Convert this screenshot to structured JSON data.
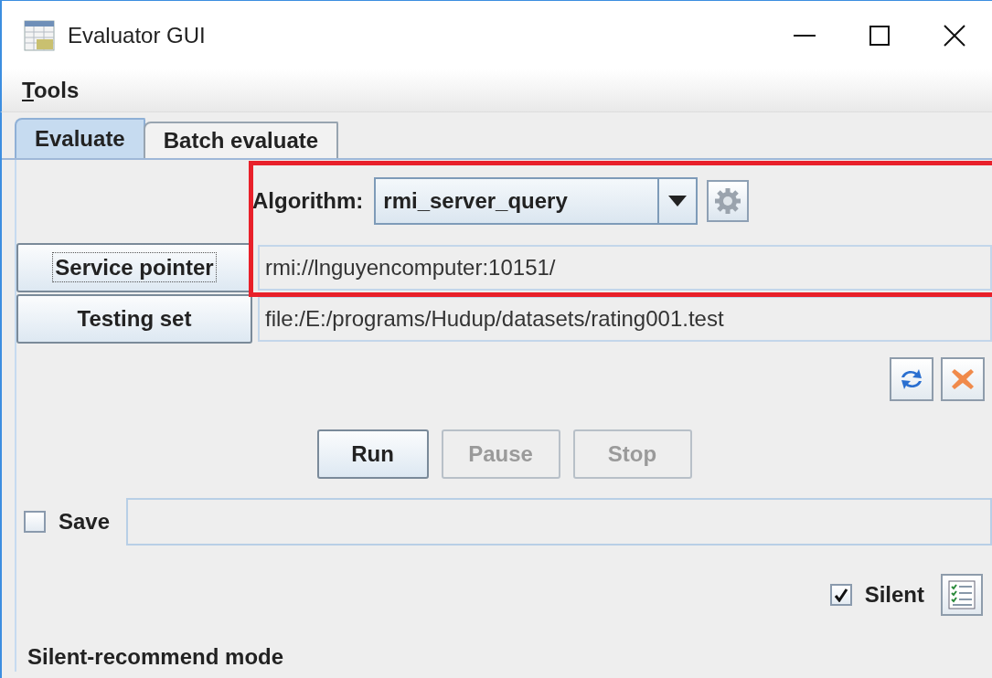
{
  "window": {
    "title": "Evaluator GUI"
  },
  "menu": [
    {
      "label": "Tools"
    }
  ],
  "tabs": [
    {
      "label": "Evaluate",
      "selected": true
    },
    {
      "label": "Batch evaluate",
      "selected": false
    }
  ],
  "algorithm": {
    "label": "Algorithm:",
    "value": "rmi_server_query"
  },
  "service_pointer": {
    "button": "Service pointer",
    "value": "rmi://lnguyencomputer:10151/",
    "focused": true
  },
  "testing_set": {
    "button": "Testing set",
    "value": "file:/E:/programs/Hudup/datasets/rating001.test",
    "focused": false
  },
  "actions": [
    {
      "label": "Run",
      "disabled": false
    },
    {
      "label": "Pause",
      "disabled": true
    },
    {
      "label": "Stop",
      "disabled": true
    }
  ],
  "save": {
    "label": "Save",
    "checked": false
  },
  "silent": {
    "label": "Silent",
    "checked": true
  },
  "status": "Silent-recommend mode"
}
